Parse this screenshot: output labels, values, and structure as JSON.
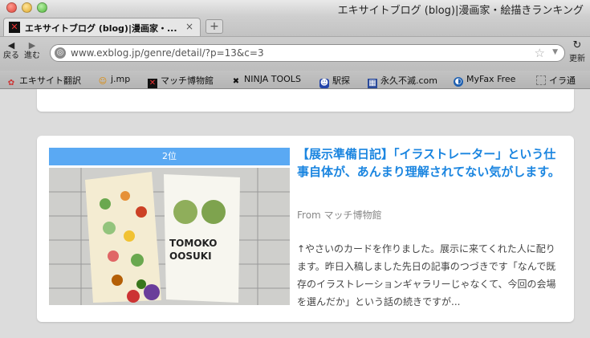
{
  "window": {
    "title": "エキサイトブログ (blog)|漫画家・絵描きランキング"
  },
  "tabs": [
    {
      "label": "エキサイトブログ (blog)|漫画家・..."
    }
  ],
  "nav": {
    "back_label": "戻る",
    "forward_label": "進む",
    "reload_label": "更新"
  },
  "url": {
    "value": "www.exblog.jp/genre/detail/?p=13&c=3"
  },
  "bookmarks": [
    {
      "label": "エキサイト翻訳",
      "icon": "excite-translate-icon"
    },
    {
      "label": "j.mp",
      "icon": "jmp-icon"
    },
    {
      "label": "マッチ博物館",
      "icon": "excite-icon"
    },
    {
      "label": "NINJA TOOLS",
      "icon": "ninja-icon"
    },
    {
      "label": "駅探",
      "icon": "ekitan-icon"
    },
    {
      "label": "永久不滅.com",
      "icon": "eikyu-icon"
    },
    {
      "label": "MyFax Free",
      "icon": "myfax-icon"
    },
    {
      "label": "イラ通",
      "icon": "blank-page-icon"
    }
  ],
  "post": {
    "rank": "2位",
    "title": "【展示準備日記】「イラストレーター」という仕事自体が、あんまり理解されてない気がします。",
    "from": "From マッチ博物館",
    "excerpt": "↑やさいのカードを作りました。展示に来てくれた人に配ります。昨日入稿しました先日の記事のつづきです「なんで既存のイラストレーションギャラリーじゃなくて、今回の会場を選んだか」という話の続きですが...",
    "card_text_line1": "TOMOKO",
    "card_text_line2": "OOSUKI"
  }
}
